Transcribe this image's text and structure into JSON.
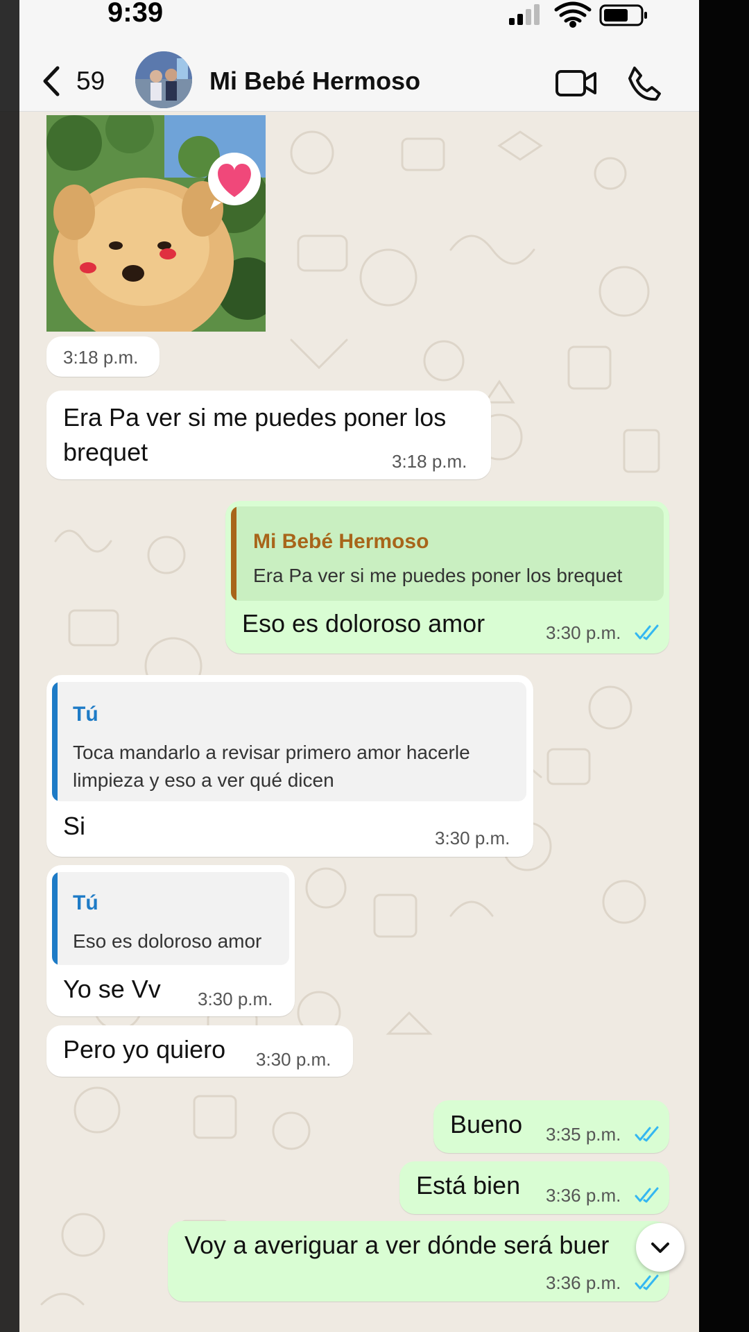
{
  "status_bar": {
    "time": "9:39"
  },
  "header": {
    "back_count": "59",
    "contact_name": "Mi Bebé Hermoso"
  },
  "messages": {
    "photo": {
      "time": "3:18 p.m."
    },
    "m1": {
      "text": "Era Pa ver si me puedes poner los brequet",
      "time": "3:18 p.m."
    },
    "m2": {
      "quote_name": "Mi Bebé Hermoso",
      "quote_text": "Era Pa ver si me puedes poner los brequet",
      "text": "Eso es doloroso amor",
      "time": "3:30 p.m."
    },
    "m3": {
      "quote_name": "Tú",
      "quote_text": "Toca mandarlo a revisar primero amor hacerle limpieza y eso a ver qué dicen",
      "text": "Si",
      "time": "3:30 p.m."
    },
    "m4": {
      "quote_name": "Tú",
      "quote_text": "Eso es doloroso amor",
      "text": "Yo se Vv",
      "time": "3:30 p.m."
    },
    "m5": {
      "text": "Pero yo quiero",
      "time": "3:30 p.m."
    },
    "m6": {
      "text": "Bueno",
      "time": "3:35 p.m."
    },
    "m7": {
      "text": "Está bien",
      "time": "3:36 p.m."
    },
    "m8": {
      "text": "Voy a averiguar a ver dónde será buer",
      "time": "3:36 p.m."
    }
  },
  "colors": {
    "chat_background": "#efeae2",
    "incoming_bubble": "#ffffff",
    "outgoing_bubble": "#d9fdd3",
    "read_ticks": "#34b7f1",
    "quote_name_contact": "#a8651a",
    "quote_name_self": "#1e7bc6"
  }
}
